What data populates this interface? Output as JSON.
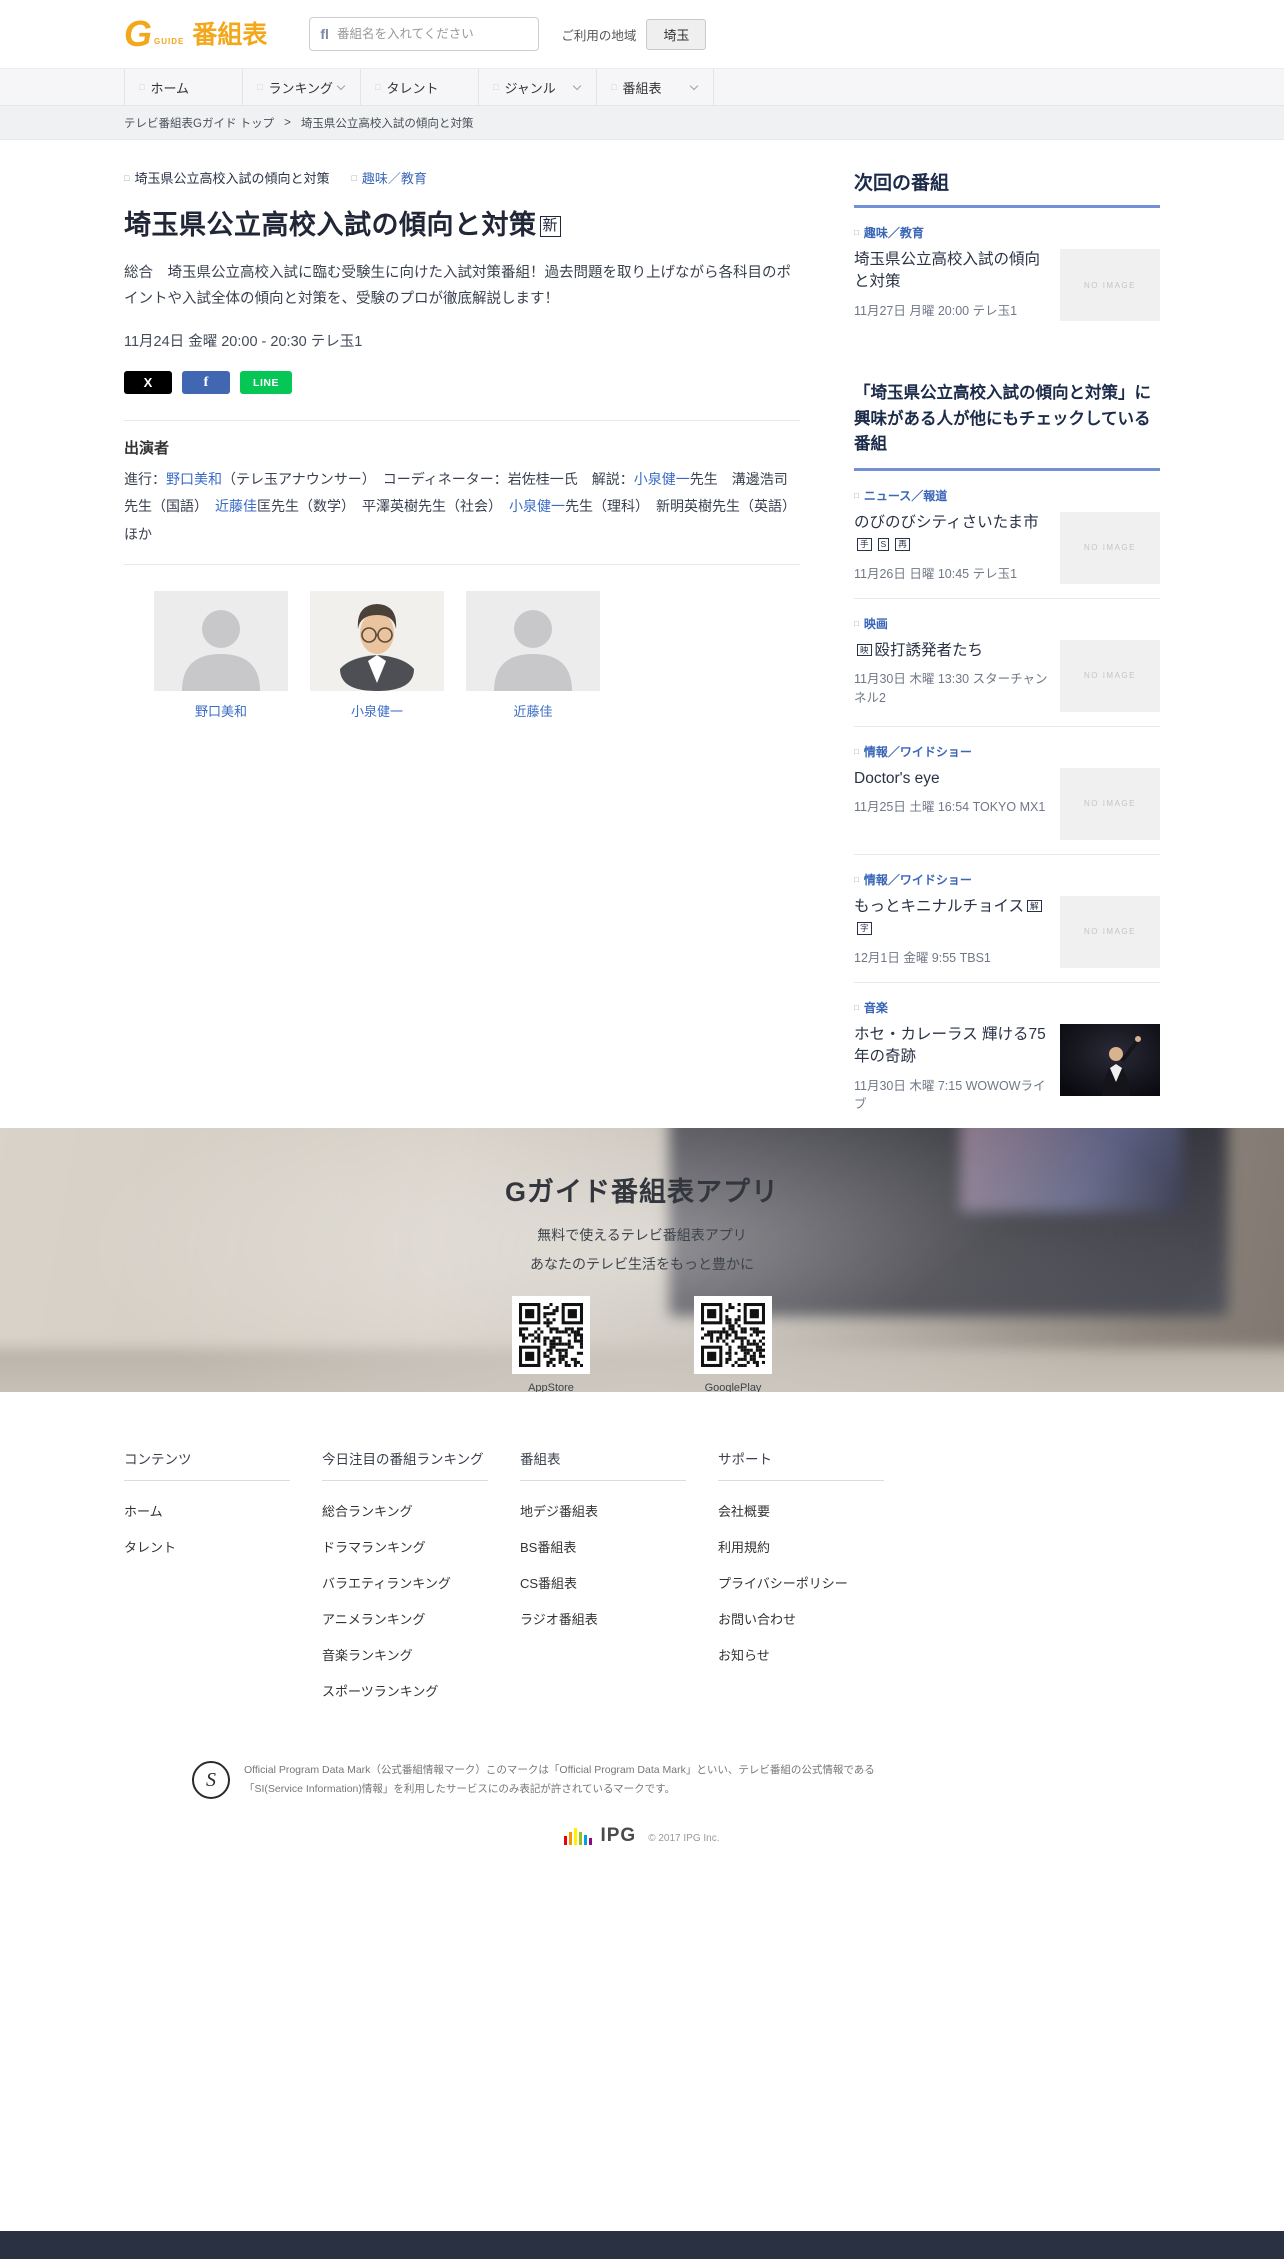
{
  "labels": {
    "no_image": "NO IMAGE"
  },
  "icons": {
    "search_icon": "fl",
    "nav_icon": "□",
    "tag_icon": "□",
    "genre_icon": "□",
    "chevron_icon": "v"
  },
  "colors": {
    "brand_orange": "#F3A81C",
    "link_blue": "#3B6BC7",
    "genre_blue": "#3A66B8",
    "heading_navy": "#1C2B4A",
    "underline_blue": "#7390D6",
    "x_black": "#000000",
    "facebook_blue": "#4267B2",
    "line_green": "#06C755",
    "bottom_bar_navy": "#2A3142"
  },
  "header": {
    "logo": {
      "g": "G",
      "guide": "GUIDE",
      "text": "番組表"
    },
    "search": {
      "placeholder": "番組名を入れてください"
    },
    "region_label": "ご利用の地域",
    "region_button": "埼玉"
  },
  "nav": {
    "items": [
      {
        "label": "ホーム",
        "chevron": false
      },
      {
        "label": "ランキング",
        "chevron": true
      },
      {
        "label": "タレント",
        "chevron": false
      },
      {
        "label": "ジャンル",
        "chevron": true
      },
      {
        "label": "番組表",
        "chevron": true
      }
    ]
  },
  "breadcrumb": {
    "home": "テレビ番組表Gガイド トップ",
    "sep": ">",
    "current": "埼玉県公立高校入試の傾向と対策"
  },
  "program": {
    "tag": "埼玉県公立高校入試の傾向と対策",
    "genre": "趣味／教育",
    "title": "埼玉県公立高校入試の傾向と対策",
    "title_badge": "新",
    "description": "総合　埼玉県公立高校入試に臨む受験生に向けた入試対策番組！過去問題を取り上げながら各科目のポイントや入試全体の傾向と対策を、受験のプロが徹底解説します！",
    "schedule": "11月24日 金曜 20:00 - 20:30 テレ玉1",
    "share": {
      "x": "X",
      "facebook": "f",
      "line": "LINE"
    }
  },
  "cast": {
    "heading": "出演者",
    "segments": [
      {
        "text": "進行：",
        "link": false
      },
      {
        "text": "野口美和",
        "link": true
      },
      {
        "text": "（テレ玉アナウンサー）　コーディネーター：岩佐桂一氏　解説：",
        "link": false
      },
      {
        "text": "小泉健一",
        "link": true
      },
      {
        "text": "先生　溝邊浩司先生（国語）　",
        "link": false
      },
      {
        "text": "近藤佳",
        "link": true
      },
      {
        "text": "匡先生（数学）　平澤英樹先生（社会）　",
        "link": false
      },
      {
        "text": "小泉健一",
        "link": true
      },
      {
        "text": "先生（理科）　新明英樹先生（英語）　ほか",
        "link": false
      }
    ],
    "cards": [
      {
        "name": "野口美和",
        "photo": "silhouette"
      },
      {
        "name": "小泉健一",
        "photo": "portrait"
      },
      {
        "name": "近藤佳",
        "photo": "silhouette"
      }
    ]
  },
  "sidebar": {
    "next": {
      "heading": "次回の番組",
      "item": {
        "genre": "趣味／教育",
        "title": "埼玉県公立高校入試の傾向と対策",
        "badges_before": [],
        "badges_after": [],
        "date": "11月27日 月曜 20:00 テレ玉1",
        "image": "noimage"
      }
    },
    "related": {
      "heading": "「埼玉県公立高校入試の傾向と対策」に興味がある人が他にもチェックしている番組",
      "items": [
        {
          "genre": "ニュース／報道",
          "title": "のびのびシティさいたま市",
          "badges_before": [],
          "badges_after": [
            "手",
            "S",
            "再"
          ],
          "date": "11月26日 日曜 10:45 テレ玉1",
          "image": "noimage"
        },
        {
          "genre": "映画",
          "title": "殴打誘発者たち",
          "badges_before": [
            "映"
          ],
          "badges_after": [],
          "date": "11月30日 木曜 13:30 スターチャンネル2",
          "image": "noimage"
        },
        {
          "genre": "情報／ワイドショー",
          "title": "Doctor's eye",
          "badges_before": [],
          "badges_after": [],
          "date": "11月25日 土曜 16:54 TOKYO MX1",
          "image": "noimage"
        },
        {
          "genre": "情報／ワイドショー",
          "title": "もっとキニナルチョイス",
          "badges_before": [],
          "badges_after": [
            "解",
            "字"
          ],
          "date": "12月1日 金曜 9:55 TBS1",
          "image": "noimage"
        },
        {
          "genre": "音楽",
          "title": "ホセ・カレーラス 輝ける75年の奇跡",
          "badges_before": [],
          "badges_after": [],
          "date": "11月30日 木曜 7:15 WOWOWライブ",
          "image": "singer"
        }
      ]
    }
  },
  "app_promo": {
    "title": "Gガイド番組表アプリ",
    "line1": "無料で使えるテレビ番組表アプリ",
    "line2": "あなたのテレビ生活をもっと豊かに",
    "stores": [
      {
        "label": "AppStore"
      },
      {
        "label": "GooglePlay"
      }
    ]
  },
  "footer": {
    "columns": [
      {
        "heading": "コンテンツ",
        "links": [
          "ホーム",
          "タレント"
        ]
      },
      {
        "heading": "今日注目の番組ランキング",
        "links": [
          "総合ランキング",
          "ドラマランキング",
          "バラエティランキング",
          "アニメランキング",
          "音楽ランキング",
          "スポーツランキング"
        ]
      },
      {
        "heading": "番組表",
        "links": [
          "地デジ番組表",
          "BS番組表",
          "CS番組表",
          "ラジオ番組表"
        ]
      },
      {
        "heading": "サポート",
        "links": [
          "会社概要",
          "利用規約",
          "プライバシーポリシー",
          "お問い合わせ",
          "お知らせ"
        ]
      }
    ],
    "official": {
      "mark": "S",
      "text": "Official Program Data Mark（公式番組情報マーク）このマークは「Official Program Data Mark」といい、テレビ番組の公式情報である「SI(Service Information)情報」を利用したサービスにのみ表記が許されているマークです。"
    },
    "ipg": {
      "name": "IPG",
      "copyright": "© 2017 IPG Inc."
    }
  }
}
